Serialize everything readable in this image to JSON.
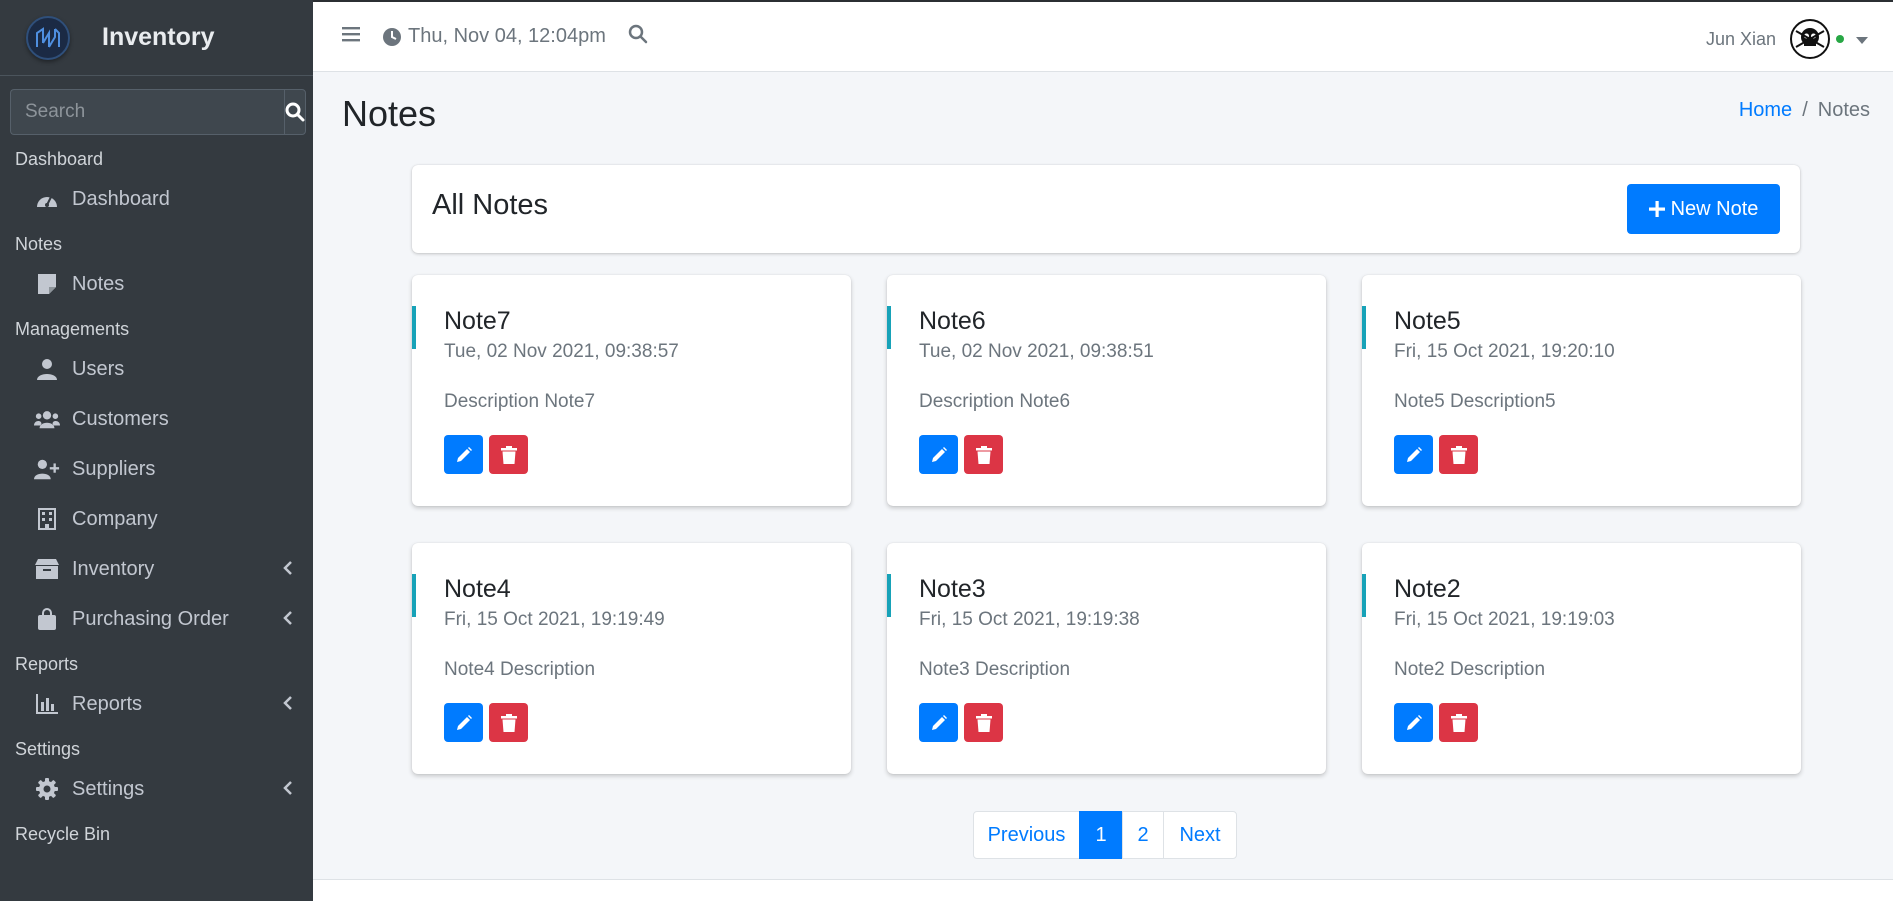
{
  "brand": {
    "name": "Inventory"
  },
  "sidebar": {
    "search_placeholder": "Search",
    "sections": [
      {
        "header": "Dashboard",
        "items": [
          {
            "label": "Dashboard",
            "icon": "dashboard-gauge-icon"
          }
        ]
      },
      {
        "header": "Notes",
        "items": [
          {
            "label": "Notes",
            "icon": "sticky-note-icon"
          }
        ]
      },
      {
        "header": "Managements",
        "items": [
          {
            "label": "Users",
            "icon": "user-icon"
          },
          {
            "label": "Customers",
            "icon": "users-icon"
          },
          {
            "label": "Suppliers",
            "icon": "user-plus-icon"
          },
          {
            "label": "Company",
            "icon": "building-icon"
          },
          {
            "label": "Inventory",
            "icon": "box-icon"
          },
          {
            "label": "Purchasing Order",
            "icon": "shopping-bag-icon"
          }
        ]
      },
      {
        "header": "Reports",
        "items": [
          {
            "label": "Reports",
            "icon": "chart-bar-icon"
          }
        ]
      },
      {
        "header": "Settings",
        "items": [
          {
            "label": "Settings",
            "icon": "gear-icon"
          }
        ]
      },
      {
        "header": "Recycle Bin",
        "items": []
      }
    ]
  },
  "topbar": {
    "datetime": "Thu, Nov 04, 12:04pm",
    "user_name": "Jun Xian"
  },
  "page": {
    "title": "Notes",
    "breadcrumb": {
      "home": "Home",
      "separator": "/",
      "current": "Notes"
    }
  },
  "notes_header": {
    "title": "All Notes",
    "new_button": "New Note"
  },
  "notes": [
    {
      "title": "Note7",
      "date": "Tue, 02 Nov 2021, 09:38:57",
      "description": "Description Note7"
    },
    {
      "title": "Note6",
      "date": "Tue, 02 Nov 2021, 09:38:51",
      "description": "Description Note6"
    },
    {
      "title": "Note5",
      "date": "Fri, 15 Oct 2021, 19:20:10",
      "description": "Note5 Description5"
    },
    {
      "title": "Note4",
      "date": "Fri, 15 Oct 2021, 19:19:49",
      "description": "Note4 Description"
    },
    {
      "title": "Note3",
      "date": "Fri, 15 Oct 2021, 19:19:38",
      "description": "Note3 Description"
    },
    {
      "title": "Note2",
      "date": "Fri, 15 Oct 2021, 19:19:03",
      "description": "Note2 Description"
    }
  ],
  "pagination": {
    "previous": "Previous",
    "pages": [
      "1",
      "2"
    ],
    "active": "1",
    "next": "Next"
  },
  "colors": {
    "primary": "#007bff",
    "danger": "#dc3545",
    "accent": "#17a2b8",
    "sidebar": "#343a40"
  }
}
